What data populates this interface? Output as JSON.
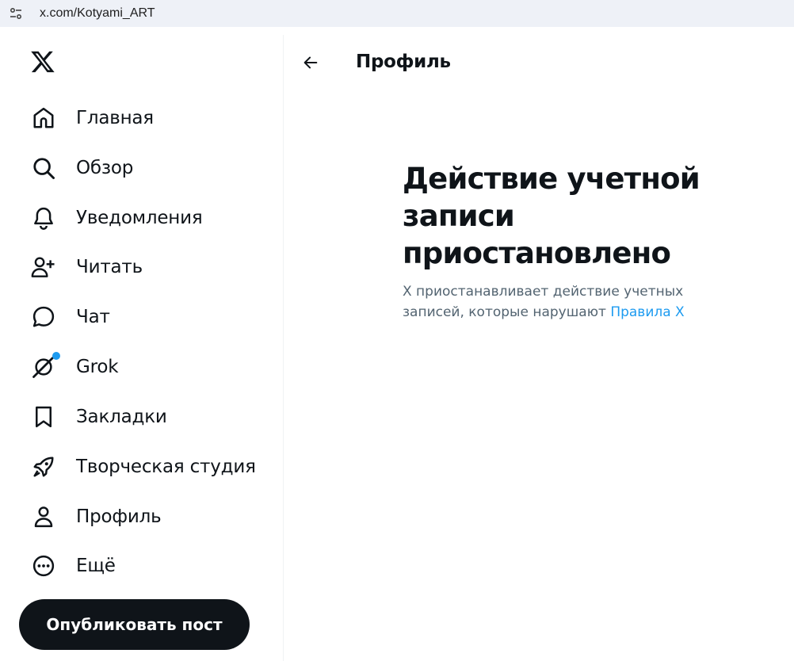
{
  "browser": {
    "url": "x.com/Kotyami_ART"
  },
  "sidebar": {
    "items": [
      {
        "label": "Главная",
        "icon": "home-icon"
      },
      {
        "label": "Обзор",
        "icon": "search-icon"
      },
      {
        "label": "Уведомления",
        "icon": "bell-icon"
      },
      {
        "label": "Читать",
        "icon": "follow-icon"
      },
      {
        "label": "Чат",
        "icon": "chat-icon"
      },
      {
        "label": "Grok",
        "icon": "grok-icon"
      },
      {
        "label": "Закладки",
        "icon": "bookmark-icon"
      },
      {
        "label": "Творческая студия",
        "icon": "rocket-icon"
      },
      {
        "label": "Профиль",
        "icon": "profile-icon"
      },
      {
        "label": "Ещё",
        "icon": "more-icon"
      }
    ],
    "post_button": "Опубликовать пост"
  },
  "main": {
    "header_title": "Профиль",
    "suspended_title": "Действие учетной записи приостановлено",
    "suspended_text": "X приостанавливает действие учетных записей, которые нарушают ",
    "rules_link": "Правила X"
  },
  "colors": {
    "accent": "#1d9bf0",
    "text": "#0f1419",
    "secondary_text": "#536471",
    "button_bg": "#0f1419"
  }
}
